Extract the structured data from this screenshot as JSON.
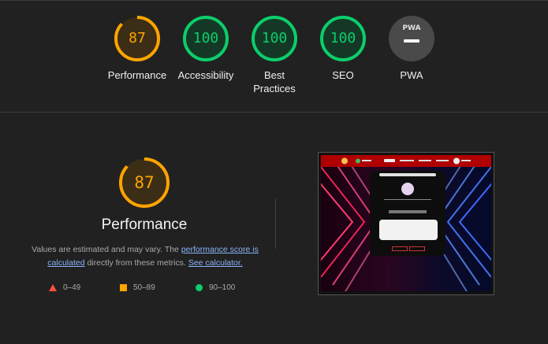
{
  "scores": [
    {
      "name": "Performance",
      "value": "87",
      "fraction": 0.87,
      "status": "average"
    },
    {
      "name": "Accessibility",
      "value": "100",
      "fraction": 1.0,
      "status": "pass"
    },
    {
      "name": "Best Practices",
      "value": "100",
      "fraction": 1.0,
      "status": "pass"
    },
    {
      "name": "SEO",
      "value": "100",
      "fraction": 1.0,
      "status": "pass"
    },
    {
      "name": "PWA",
      "value": "PWA",
      "status": "na"
    }
  ],
  "colors": {
    "average": "#ffa400",
    "pass": "#0cce6b",
    "fail": "#ff4e42",
    "na_bg": "#4a4a4a"
  },
  "detail": {
    "score": "87",
    "fraction": 0.87,
    "title": "Performance",
    "desc_prefix": "Values are estimated and may vary. The ",
    "link1": "performance score is calculated",
    "desc_mid": " directly from these metrics. ",
    "link2": "See calculator."
  },
  "legend": {
    "fail": "0–49",
    "average": "50–89",
    "pass": "90–100"
  }
}
